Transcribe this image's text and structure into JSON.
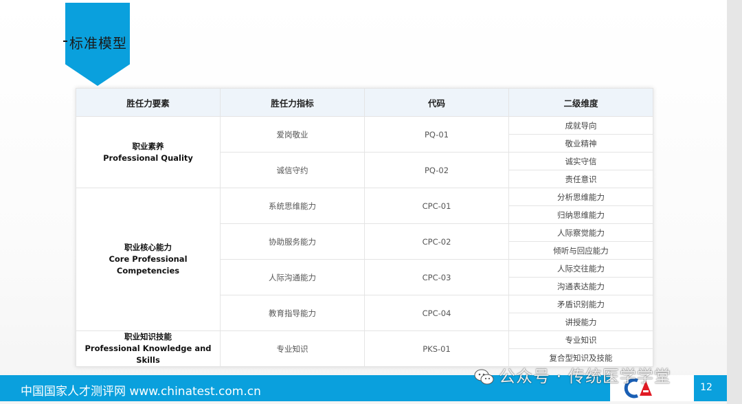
{
  "slide": {
    "title": "标准模型",
    "page_number": "12"
  },
  "table": {
    "headers": [
      "胜任力要素",
      "胜任力指标",
      "代码",
      "二级维度"
    ],
    "groups": [
      {
        "element_cn": "职业素养",
        "element_en": "Professional Quality",
        "indicators": [
          {
            "name": "爱岗敬业",
            "code": "PQ-01",
            "dims": [
              "成就导向",
              "敬业精神"
            ]
          },
          {
            "name": "诚信守约",
            "code": "PQ-02",
            "dims": [
              "诚实守信",
              "责任意识"
            ]
          }
        ]
      },
      {
        "element_cn": "职业核心能力",
        "element_en": "Core Professional Competencies",
        "indicators": [
          {
            "name": "系统思维能力",
            "code": "CPC-01",
            "dims": [
              "分析思维能力",
              "归纳思维能力"
            ]
          },
          {
            "name": "协助服务能力",
            "code": "CPC-02",
            "dims": [
              "人际察觉能力",
              "倾听与回应能力"
            ]
          },
          {
            "name": "人际沟通能力",
            "code": "CPC-03",
            "dims": [
              "人际交往能力",
              "沟通表达能力"
            ]
          },
          {
            "name": "教育指导能力",
            "code": "CPC-04",
            "dims": [
              "矛盾识别能力",
              "讲授能力"
            ]
          }
        ]
      },
      {
        "element_cn": "职业知识技能",
        "element_en": "Professional Knowledge and Skills",
        "indicators": [
          {
            "name": "专业知识",
            "code": "PKS-01",
            "dims": [
              "专业知识",
              "复合型知识及技能"
            ]
          }
        ]
      }
    ]
  },
  "footer": {
    "text": "中国国家人才测评网 www.chinatest.com.cn"
  },
  "watermark": {
    "text": "公众号 · 传统医学学堂",
    "icon": "wechat-icon"
  },
  "logo": {
    "text": "CA",
    "colors": {
      "c": "#1a5fb4",
      "a": "#e01b24"
    }
  },
  "colors": {
    "accent": "#0aa0dd",
    "header_bg": "#eef4fa"
  }
}
